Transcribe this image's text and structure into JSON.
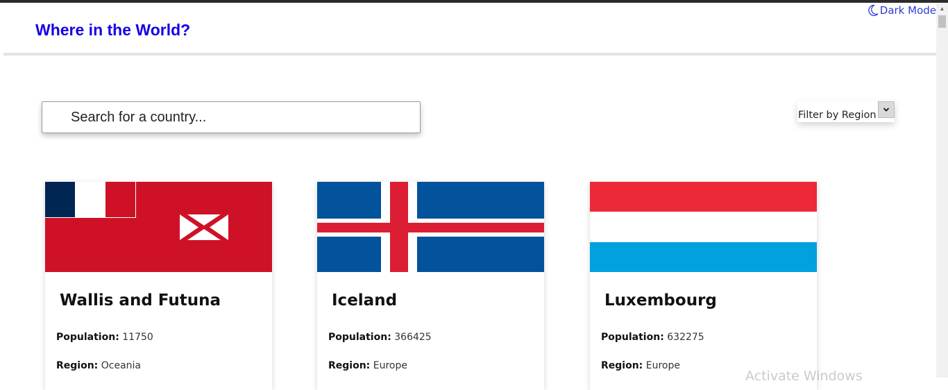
{
  "header": {
    "title": "Where in the World?",
    "dark_mode_label": "Dark Mode",
    "title_color": "#1400e6",
    "toggle_color": "#2d3bd6"
  },
  "search": {
    "placeholder": "Search for a country...",
    "value": "",
    "icon": "search-icon"
  },
  "filter": {
    "selected": "Filter by Region",
    "icon": "chevron-down-icon"
  },
  "countries": [
    {
      "name": "Wallis and Futuna",
      "population_label": "Population:",
      "population": "11750",
      "region_label": "Region:",
      "region": "Oceania",
      "flag_colors": [
        "#ce1126",
        "#002395",
        "#ffffff"
      ]
    },
    {
      "name": "Iceland",
      "population_label": "Population:",
      "population": "366425",
      "region_label": "Region:",
      "region": "Europe",
      "flag_colors": [
        "#02529c",
        "#ffffff",
        "#dc1e35"
      ]
    },
    {
      "name": "Luxembourg",
      "population_label": "Population:",
      "population": "632275",
      "region_label": "Region:",
      "region": "Europe",
      "flag_colors": [
        "#ed2939",
        "#ffffff",
        "#00a1de"
      ]
    }
  ],
  "os_watermark": "Activate Windows"
}
